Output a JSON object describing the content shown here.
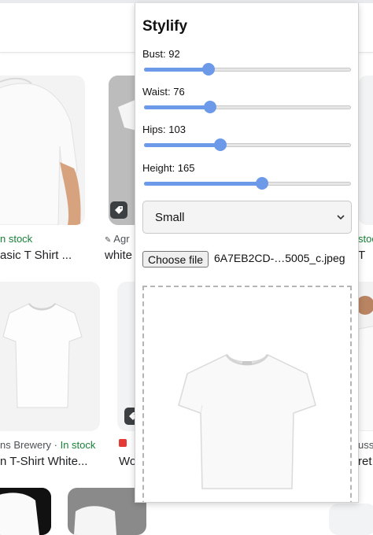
{
  "background": {
    "results_row1": [
      {
        "source": "n stock",
        "stock": "",
        "title": "asic T Shirt ..."
      },
      {
        "source": "Agr",
        "stock": "",
        "title": "white"
      },
      {
        "source": "",
        "stock": "stock",
        "title": "T"
      }
    ],
    "results_row2": [
      {
        "source": "ns Brewery · ",
        "stock": "In stock",
        "title": "n T-Shirt White..."
      },
      {
        "source": "Wo",
        "stock": "",
        "title": ""
      },
      {
        "source": "uss",
        "stock": "",
        "title": "ret"
      }
    ]
  },
  "popup": {
    "title": "Stylify",
    "sliders": [
      {
        "label": "Bust: 92",
        "value": 92,
        "fraction": 0.31
      },
      {
        "label": "Waist: 76",
        "value": 76,
        "fraction": 0.32
      },
      {
        "label": "Hips: 103",
        "value": 103,
        "fraction": 0.37
      },
      {
        "label": "Height: 165",
        "value": 165,
        "fraction": 0.57
      }
    ],
    "size_select": {
      "selected": "Small"
    },
    "file_input": {
      "button_label": "Choose file",
      "file_name": "6A7EB2CD-…5005_c.jpeg"
    }
  },
  "colors": {
    "accent": "#6d9ae8",
    "in_stock": "#188038"
  }
}
